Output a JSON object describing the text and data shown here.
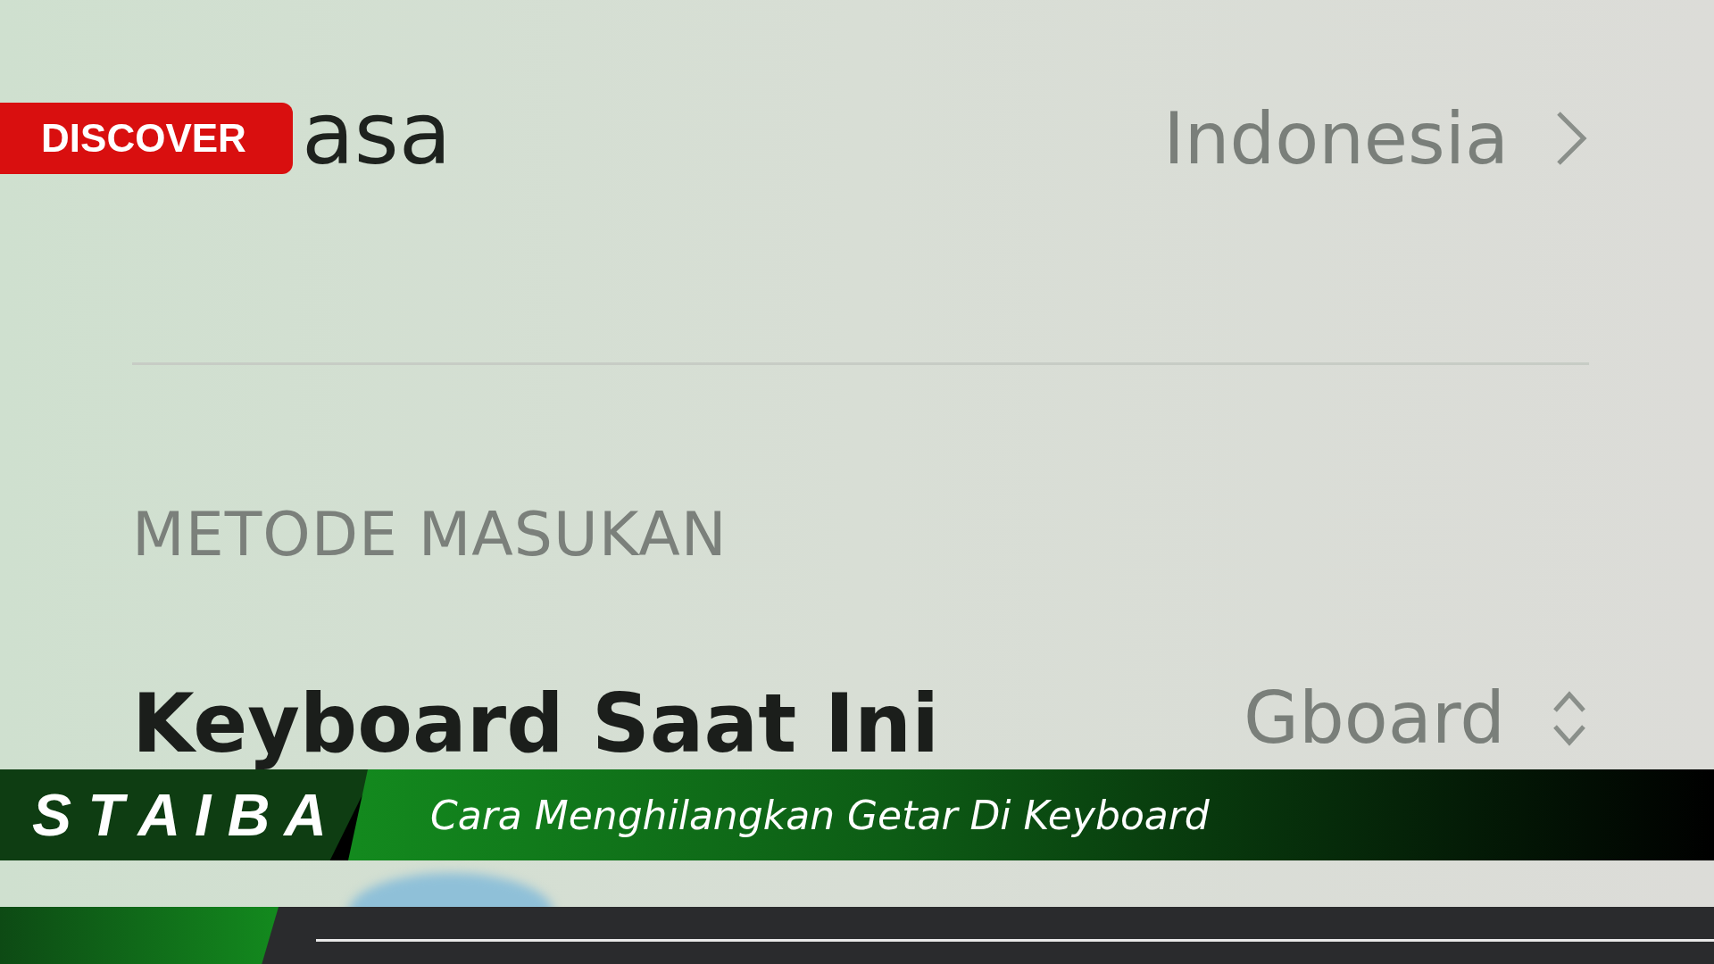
{
  "settings": {
    "language_row": {
      "label": "asa",
      "value": "Indonesia"
    },
    "section_header": "METODE MASUKAN",
    "keyboard_row": {
      "label": "Keyboard Saat Ini",
      "value": "Gboard"
    }
  },
  "badge": "DISCOVER",
  "banner": {
    "brand": "S T A I B A",
    "title": "Cara Menghilangkan Getar Di Keyboard"
  }
}
